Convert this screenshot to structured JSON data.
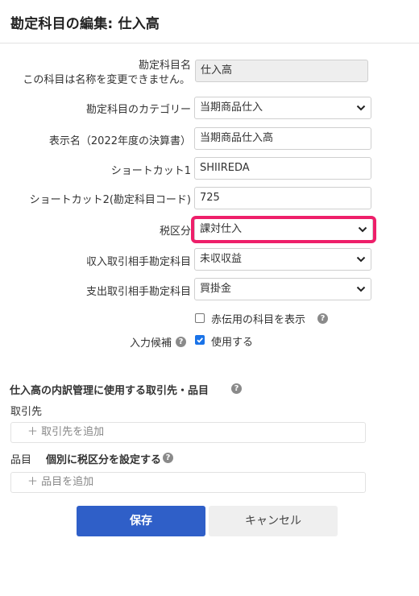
{
  "dialog": {
    "title": "勘定科目の編集: 仕入高"
  },
  "form": {
    "account_name_label_line1": "勘定科目名",
    "account_name_label_line2": "この科目は名称を変更できません。",
    "account_name_value": "仕入高",
    "category_label": "勘定科目のカテゴリー",
    "category_value": "当期商品仕入",
    "display_name_label": "表示名（2022年度の決算書）",
    "display_name_value": "当期商品仕入高",
    "shortcut1_label": "ショートカット1",
    "shortcut1_value": "SHIIREDA",
    "shortcut2_label": "ショートカット2(勘定科目コード)",
    "shortcut2_value": "725",
    "tax_category_label": "税区分",
    "tax_category_value": "課対仕入",
    "income_counter_label": "収入取引相手勘定科目",
    "income_counter_value": "未収収益",
    "expense_counter_label": "支出取引相手勘定科目",
    "expense_counter_value": "買掛金",
    "show_red_label": "赤伝用の科目を表示",
    "show_red_checked": false,
    "input_candidate_label": "入力候補",
    "use_label": "使用する",
    "use_checked": true
  },
  "breakdown": {
    "title": "仕入高の内訳管理に使用する取引先・品目",
    "partner_label": "取引先",
    "partner_add": "＋ 取引先を追加",
    "item_label": "品目",
    "item_tax_label": "個別に税区分を設定する",
    "item_add": "＋ 品目を追加"
  },
  "buttons": {
    "save": "保存",
    "cancel": "キャンセル"
  },
  "colors": {
    "primary": "#2f5fc8",
    "highlight": "#ee1f6a",
    "checkbox": "#1a73e8"
  }
}
